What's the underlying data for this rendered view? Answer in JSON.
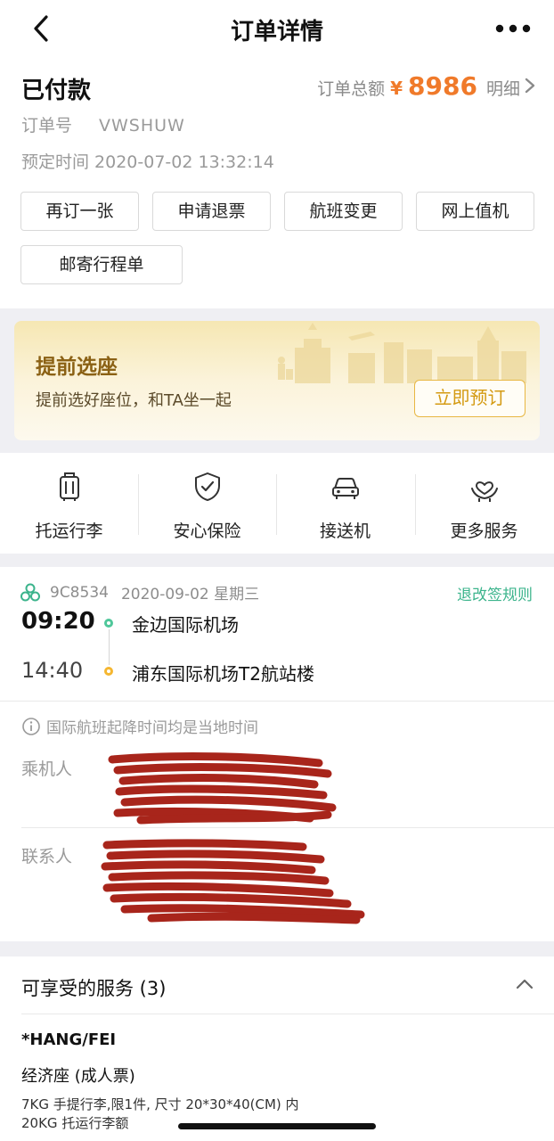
{
  "header": {
    "title": "订单详情",
    "back_icon": "chevron-left-icon",
    "more_icon": "more-horizontal-icon"
  },
  "order": {
    "status": "已付款",
    "total_label": "订单总额",
    "currency": "¥",
    "total_amount": "8986",
    "detail_label": "明细",
    "order_no_label": "订单号",
    "order_no": "VWSHUW",
    "booking_time_label": "预定时间",
    "booking_time": "2020-07-02 13:32:14",
    "accent_color": "#f07a2a"
  },
  "actions": [
    {
      "label": "再订一张"
    },
    {
      "label": "申请退票"
    },
    {
      "label": "航班变更"
    },
    {
      "label": "网上值机"
    },
    {
      "label": "邮寄行程单"
    }
  ],
  "seat_promo": {
    "title": "提前选座",
    "subtitle": "提前选好座位，和TA坐一起",
    "button": "立即预订"
  },
  "services": [
    {
      "label": "托运行李",
      "icon": "luggage-icon"
    },
    {
      "label": "安心保险",
      "icon": "shield-check-icon"
    },
    {
      "label": "接送机",
      "icon": "car-icon"
    },
    {
      "label": "更多服务",
      "icon": "heart-hands-icon"
    }
  ],
  "flight": {
    "airline_icon": "airline-logo-icon",
    "flight_no": "9C8534",
    "date": "2020-09-02 星期三",
    "rule_link": "退改签规则",
    "dep_time": "09:20",
    "dep_airport": "金边国际机场",
    "arr_time": "14:40",
    "arr_airport": "浦东国际机场T2航站楼",
    "notice": "国际航班起降时间均是当地时间",
    "passenger_label": "乘机人",
    "contact_label": "联系人"
  },
  "benefits": {
    "title": "可享受的服务 (3)",
    "item_code": "*HANG/FEI",
    "item_class": "经济座 (成人票)",
    "line1": "7KG 手提行李,限1件, 尺寸 20*30*40(CM) 内",
    "line2": "20KG 托运行李额"
  }
}
